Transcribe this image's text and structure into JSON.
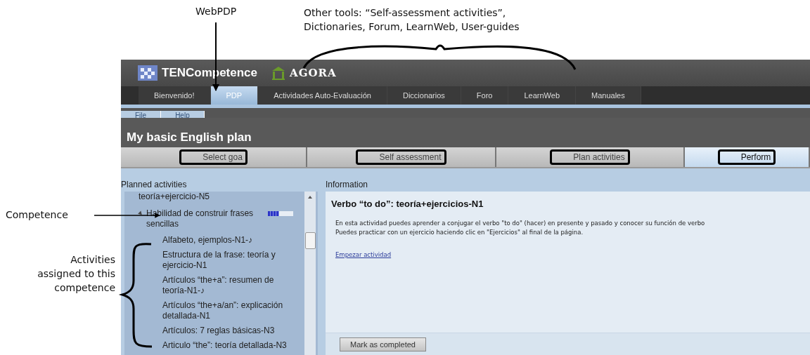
{
  "annotations": {
    "webpdp": "WebPDP",
    "other_tools": [
      "Other tools: “Self-assessment activities”,",
      "Dictionaries, Forum, LearnWeb, User-guides"
    ],
    "competence": "Competence",
    "activities": [
      "Activities",
      "assigned to this",
      "competence"
    ]
  },
  "header": {
    "brand": "TENCompetence",
    "logo": "AGORA"
  },
  "tabs": [
    {
      "label": "Bienvenido!",
      "selected": false
    },
    {
      "label": "PDP",
      "selected": true
    },
    {
      "label": "Actividades Auto-Evaluación",
      "selected": false
    },
    {
      "label": "Diccionarios",
      "selected": false
    },
    {
      "label": "Foro",
      "selected": false
    },
    {
      "label": "LearnWeb",
      "selected": false
    },
    {
      "label": "Manuales",
      "selected": false
    }
  ],
  "menu": [
    "File",
    "Help"
  ],
  "plan_title": "My basic English plan",
  "steps": [
    {
      "label": "Select goa",
      "selected": false
    },
    {
      "label": "Self assessment",
      "selected": false
    },
    {
      "label": "Plan activities",
      "selected": false
    },
    {
      "label": "Perform",
      "selected": true
    }
  ],
  "planned_activities": {
    "title": "Planned activities",
    "items": [
      {
        "kind": "activity",
        "label": "teoría+ejercicio-N5"
      },
      {
        "kind": "competence",
        "label": "Habilidad de construir frases sencillas",
        "expanded": true,
        "level": 0.45,
        "children": [
          {
            "kind": "activity",
            "label": "Alfabeto, ejemplos-N1-♪"
          },
          {
            "kind": "activity",
            "label": "Estructura de la frase: teoría y ejercicio-N1"
          },
          {
            "kind": "activity",
            "label": "Artículos “the+a”: resumen de teoría-N1-♪"
          },
          {
            "kind": "activity",
            "label": "Artículos “the+a/an”: explicación detallada-N1"
          },
          {
            "kind": "activity",
            "label": "Artículos: 7 reglas básicas-N3"
          },
          {
            "kind": "activity",
            "label": "Articulo “the”: teoría detallada-N3"
          }
        ]
      }
    ]
  },
  "information": {
    "title": "Information",
    "heading": "Verbo “to do”: teoría+ejercicios-N1",
    "paragraph": "En esta actividad puedes aprender a conjugar el verbo \"to do\" (hacer) en presente y pasado y conocer su función de verbo\nPuedes practicar con un ejercicio haciendo clic en \"Ejercicios\" al final de la página.",
    "link": "Empezar actividad",
    "button": "Mark as completed"
  }
}
